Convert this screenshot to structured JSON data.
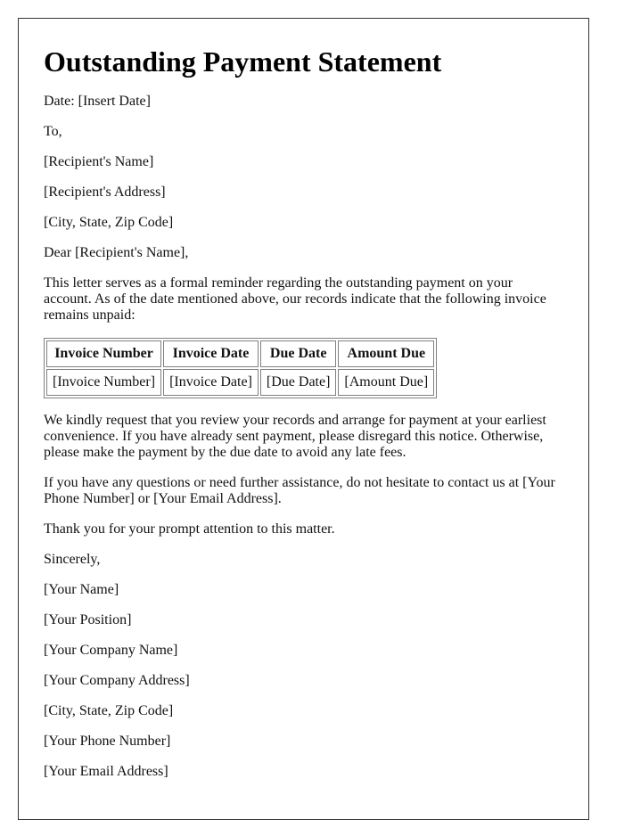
{
  "title": "Outstanding Payment Statement",
  "date_line": "Date: [Insert Date]",
  "salutation_to": "To,",
  "recipient": {
    "name": "[Recipient's Name]",
    "address": "[Recipient's Address]",
    "city_state_zip": "[City, State, Zip Code]"
  },
  "greeting": "Dear [Recipient's Name],",
  "intro_paragraph": "This letter serves as a formal reminder regarding the outstanding payment on your account. As of the date mentioned above, our records indicate that the following invoice remains unpaid:",
  "invoice_table": {
    "headers": [
      "Invoice Number",
      "Invoice Date",
      "Due Date",
      "Amount Due"
    ],
    "rows": [
      [
        "[Invoice Number]",
        "[Invoice Date]",
        "[Due Date]",
        "[Amount Due]"
      ]
    ]
  },
  "request_paragraph": "We kindly request that you review your records and arrange for payment at your earliest convenience. If you have already sent payment, please disregard this notice. Otherwise, please make the payment by the due date to avoid any late fees.",
  "contact_paragraph": "If you have any questions or need further assistance, do not hesitate to contact us at [Your Phone Number] or [Your Email Address].",
  "thanks_paragraph": "Thank you for your prompt attention to this matter.",
  "closing": "Sincerely,",
  "sender": {
    "name": "[Your Name]",
    "position": "[Your Position]",
    "company_name": "[Your Company Name]",
    "company_address": "[Your Company Address]",
    "city_state_zip": "[City, State, Zip Code]",
    "phone": "[Your Phone Number]",
    "email": "[Your Email Address]"
  }
}
